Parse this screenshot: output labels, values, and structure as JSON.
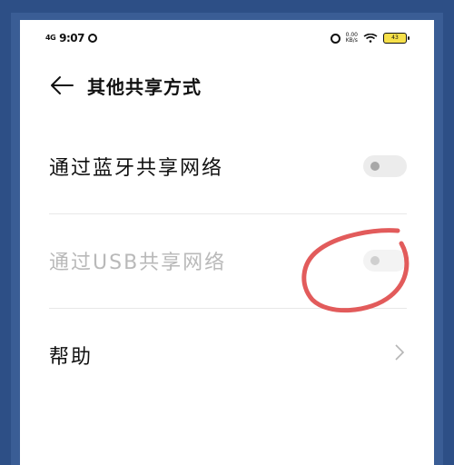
{
  "status_bar": {
    "network": "4G",
    "time": "9:07",
    "speed_value": "0.00",
    "speed_unit": "KB/s",
    "battery": "43"
  },
  "header": {
    "title": "其他共享方式",
    "back_icon": "arrow-left-icon"
  },
  "settings": [
    {
      "label": "通过蓝牙共享网络",
      "type": "toggle",
      "enabled": true,
      "checked": false
    },
    {
      "label": "通过USB共享网络",
      "type": "toggle",
      "enabled": false,
      "checked": false
    },
    {
      "label": "帮助",
      "type": "link",
      "icon": "chevron-right-icon"
    }
  ],
  "colors": {
    "frame": "#2d4f86",
    "annotation": "#e25b5b",
    "toggle_bg": "#ececec"
  }
}
